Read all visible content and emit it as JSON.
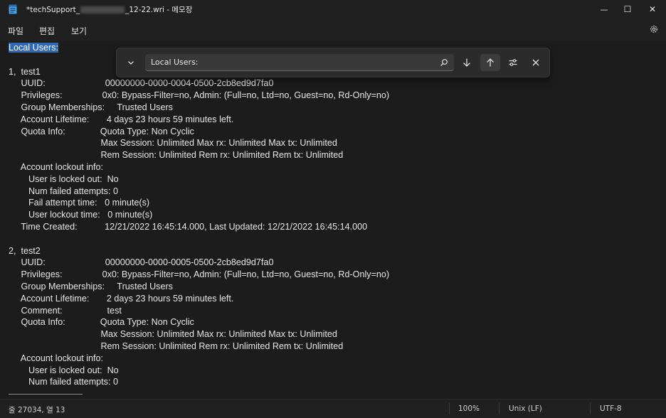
{
  "window": {
    "title_prefix": "*techSupport_",
    "title_suffix": "_12-22.wri - 메모장",
    "minimize": "—",
    "maximize": "☐",
    "close": "✕"
  },
  "menu": {
    "file": "파일",
    "edit": "편집",
    "view": "보기"
  },
  "icons": {
    "app": "notepad-icon",
    "settings": "gear-icon"
  },
  "find": {
    "value": "Local Users:",
    "expand_icon": "chevron-down-icon",
    "search_icon": "search-icon",
    "next_icon": "arrow-down-icon",
    "prev_icon": "arrow-up-icon",
    "options_icon": "sliders-icon",
    "close_icon": "close-icon"
  },
  "document": {
    "lines": [
      "Local Users:",
      "",
      "1,  test1",
      "     UUID:                        00000000-0000-0004-0500-2cb8ed9d7fa0",
      "     Privileges:                0x0: Bypass-Filter=no, Admin: (Full=no, Ltd=no, Guest=no, Rd-Only=no)",
      "     Group Memberships:     Trusted Users",
      "     Account Lifetime:       4 days 23 hours 59 minutes left.",
      "     Quota Info:              Quota Type: Non Cyclic",
      "                                     Max Session: Unlimited Max rx: Unlimited Max tx: Unlimited",
      "                                     Rem Session: Unlimited Rem rx: Unlimited Rem tx: Unlimited",
      "     Account lockout info:",
      "        User is locked out:  No",
      "        Num failed attempts: 0",
      "        Fail attempt time:   0 minute(s)",
      "        User lockout time:   0 minute(s)",
      "     Time Created:           12/21/2022 16:45:14.000, Last Updated: 12/21/2022 16:45:14.000",
      "",
      "2,  test2",
      "     UUID:                        00000000-0000-0005-0500-2cb8ed9d7fa0",
      "     Privileges:                0x0: Bypass-Filter=no, Admin: (Full=no, Ltd=no, Guest=no, Rd-Only=no)",
      "     Group Memberships:     Trusted Users",
      "     Account Lifetime:       2 days 23 hours 59 minutes left.",
      "     Comment:                  test",
      "     Quota Info:              Quota Type: Non Cyclic",
      "                                     Max Session: Unlimited Max rx: Unlimited Max tx: Unlimited",
      "                                     Rem Session: Unlimited Rem rx: Unlimited Rem tx: Unlimited",
      "     Account lockout info:",
      "        User is locked out:  No",
      "        Num failed attempts: 0"
    ]
  },
  "status": {
    "position": "줄 27034, 열 13",
    "zoom": "100%",
    "line_ending": "Unix (LF)",
    "encoding": "UTF-8"
  },
  "colors": {
    "background": "#1c1c1c",
    "selection": "#2f67b0",
    "text": "#e6e6e6"
  }
}
